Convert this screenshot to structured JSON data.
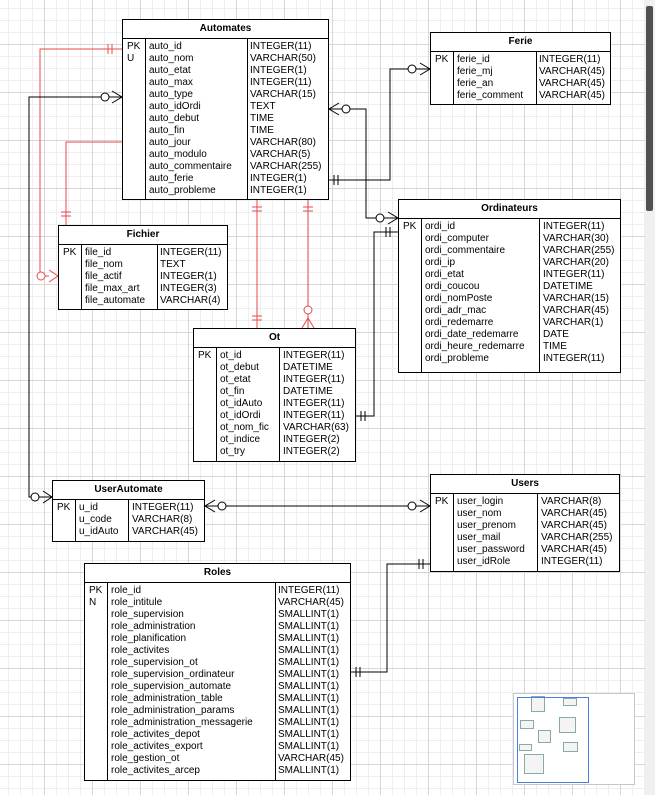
{
  "diagram": {
    "entities": [
      {
        "id": "automates",
        "title": "Automates",
        "keys": [
          "PK",
          "U",
          "",
          "",
          "",
          "",
          "",
          "",
          "",
          "",
          "",
          "",
          "",
          ""
        ],
        "names": [
          "auto_id",
          "auto_nom",
          "auto_etat",
          "auto_max",
          "auto_type",
          "auto_idOrdi",
          "auto_debut",
          "auto_fin",
          "auto_jour",
          "auto_modulo",
          "auto_commentaire",
          "auto_ferie",
          "auto_probleme"
        ],
        "types": [
          "INTEGER(11)",
          "VARCHAR(50)",
          "INTEGER(1)",
          "INTEGER(11)",
          "VARCHAR(15)",
          "TEXT",
          "TIME",
          "TIME",
          "VARCHAR(80)",
          "VARCHAR(5)",
          "VARCHAR(255)",
          "INTEGER(1)",
          "INTEGER(1)"
        ]
      },
      {
        "id": "ferie",
        "title": "Ferie",
        "keys": [
          "PK",
          "",
          "",
          ""
        ],
        "names": [
          "ferie_id",
          "ferie_mj",
          "ferie_an",
          "ferie_comment"
        ],
        "types": [
          "INTEGER(11)",
          "VARCHAR(45)",
          "VARCHAR(45)",
          "VARCHAR(45)"
        ]
      },
      {
        "id": "ordinateurs",
        "title": "Ordinateurs",
        "keys": [
          "PK",
          "",
          "",
          "",
          "",
          "",
          "",
          "",
          "",
          "",
          "",
          ""
        ],
        "names": [
          "ordi_id",
          "ordi_computer",
          "ordi_commentaire",
          "ordi_ip",
          "ordi_etat",
          "ordi_coucou",
          "ordi_nomPoste",
          "ordi_adr_mac",
          "ordi_redemarre",
          "ordi_date_redemarre",
          "ordi_heure_redemarre",
          "ordi_probleme"
        ],
        "types": [
          "INTEGER(11)",
          "VARCHAR(30)",
          "VARCHAR(255)",
          "VARCHAR(20)",
          "INTEGER(11)",
          "DATETIME",
          "VARCHAR(15)",
          "VARCHAR(45)",
          "VARCHAR(1)",
          "DATE",
          "TIME",
          "INTEGER(11)"
        ]
      },
      {
        "id": "fichier",
        "title": "Fichier",
        "keys": [
          "PK",
          "",
          "",
          "",
          ""
        ],
        "names": [
          "file_id",
          "file_nom",
          "file_actif",
          "file_max_art",
          "file_automate"
        ],
        "types": [
          "INTEGER(11)",
          "TEXT",
          "INTEGER(1)",
          "INTEGER(3)",
          "VARCHAR(4)"
        ]
      },
      {
        "id": "ot",
        "title": "Ot",
        "keys": [
          "PK",
          "",
          "",
          "",
          "",
          "",
          "",
          "",
          ""
        ],
        "names": [
          "ot_id",
          "ot_debut",
          "ot_etat",
          "ot_fin",
          "ot_idAuto",
          "ot_idOrdi",
          "ot_nom_fic",
          "ot_indice",
          "ot_try"
        ],
        "types": [
          "INTEGER(11)",
          "DATETIME",
          "INTEGER(11)",
          "DATETIME",
          "INTEGER(11)",
          "INTEGER(11)",
          "VARCHAR(63)",
          "INTEGER(2)",
          "INTEGER(2)"
        ]
      },
      {
        "id": "userautomate",
        "title": "UserAutomate",
        "keys": [
          "PK",
          "",
          ""
        ],
        "names": [
          "u_id",
          "u_code",
          "u_idAuto"
        ],
        "types": [
          "INTEGER(11)",
          "VARCHAR(8)",
          "VARCHAR(45)"
        ]
      },
      {
        "id": "users",
        "title": "Users",
        "keys": [
          "PK",
          "",
          "",
          "",
          "",
          ""
        ],
        "names": [
          "user_login",
          "user_nom",
          "user_prenom",
          "user_mail",
          "user_password",
          "user_idRole"
        ],
        "types": [
          "VARCHAR(8)",
          "VARCHAR(45)",
          "VARCHAR(45)",
          "VARCHAR(255)",
          "VARCHAR(45)",
          "INTEGER(11)"
        ]
      },
      {
        "id": "roles",
        "title": "Roles",
        "keys": [
          "PK",
          "N",
          "",
          "",
          "",
          "",
          "",
          "",
          "",
          "",
          "",
          "",
          "",
          "",
          "",
          ""
        ],
        "names": [
          "role_id",
          "role_intitule",
          "role_supervision",
          "role_administration",
          "role_planification",
          "role_activites",
          "role_supervision_ot",
          "role_supervision_ordinateur",
          "role_supervision_automate",
          "role_administration_table",
          "role_administration_params",
          "role_administration_messagerie",
          "role_activites_depot",
          "role_activites_export",
          "role_gestion_ot",
          "role_activites_arcep"
        ],
        "types": [
          "INTEGER(11)",
          "VARCHAR(45)",
          "SMALLINT(1)",
          "SMALLINT(1)",
          "SMALLINT(1)",
          "SMALLINT(1)",
          "SMALLINT(1)",
          "SMALLINT(1)",
          "SMALLINT(1)",
          "SMALLINT(1)",
          "SMALLINT(1)",
          "SMALLINT(1)",
          "SMALLINT(1)",
          "SMALLINT(1)",
          "VARCHAR(45)",
          "SMALLINT(1)"
        ]
      }
    ],
    "colors": {
      "red_relation": "#e84a4a",
      "black_relation": "#000000",
      "grid": "#d6d6d6",
      "minimap_view": "#4a7fe0"
    }
  }
}
